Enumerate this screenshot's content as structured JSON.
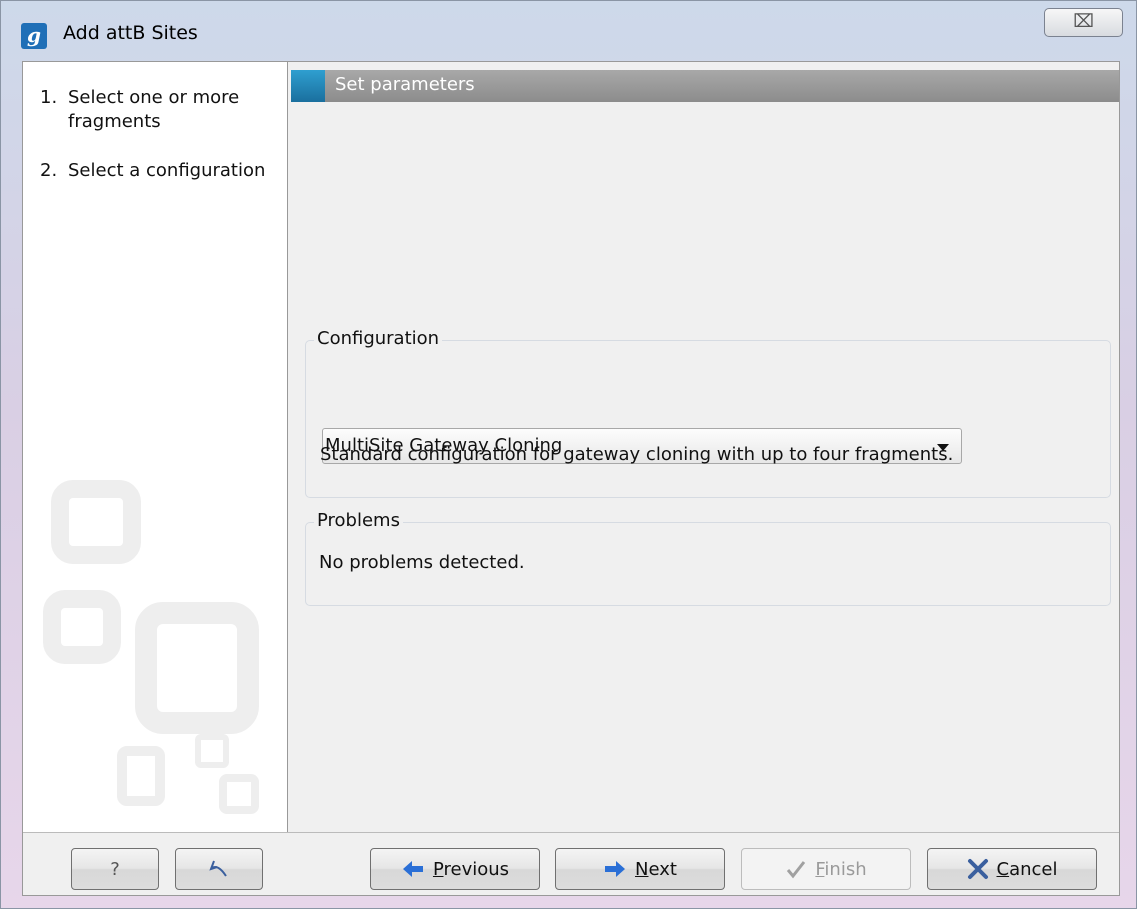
{
  "window": {
    "title": "Add attB Sites",
    "app_icon_letter": "g",
    "close_symbol": "⌧"
  },
  "sidebar": {
    "steps": [
      {
        "number": "1.",
        "label": "Select one or more fragments"
      },
      {
        "number": "2.",
        "label": "Select a configuration"
      }
    ]
  },
  "main": {
    "header": "Set parameters",
    "configuration": {
      "legend": "Configuration",
      "selected": "MultiSite Gateway Cloning",
      "description": "Standard configuration for gateway cloning with up to four fragments."
    },
    "problems": {
      "legend": "Problems",
      "message": "No problems detected."
    }
  },
  "footer": {
    "help_label": "?",
    "previous": {
      "pre": "",
      "accel": "P",
      "post": "revious"
    },
    "next": {
      "pre": "",
      "accel": "N",
      "post": "ext"
    },
    "finish": {
      "pre": "",
      "accel": "F",
      "post": "inish"
    },
    "cancel": {
      "pre": "",
      "accel": "C",
      "post": "ancel"
    }
  },
  "colors": {
    "accent": "#1f6fb7",
    "arrow_blue": "#2a6fd6",
    "cancel_x": "#3a5f9e"
  }
}
